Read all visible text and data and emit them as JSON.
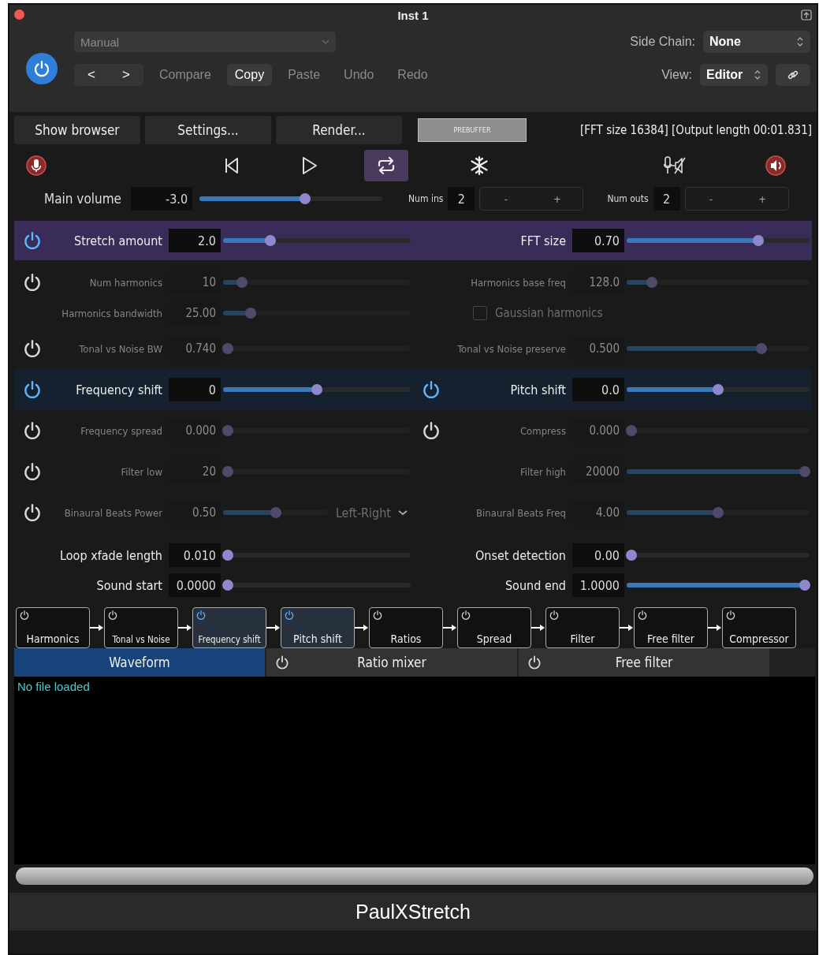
{
  "window": {
    "title": "Inst 1"
  },
  "header": {
    "power": {
      "on": true
    },
    "preset": {
      "value": "Manual",
      "disabled": true
    },
    "nav": [
      {
        "label": "<"
      },
      {
        "label": ">"
      }
    ],
    "buttons": [
      {
        "label": "Compare",
        "disabled": true
      },
      {
        "label": "Copy",
        "disabled": false
      },
      {
        "label": "Paste",
        "disabled": true
      },
      {
        "label": "Undo",
        "disabled": true
      },
      {
        "label": "Redo",
        "disabled": true
      }
    ],
    "side_chain": {
      "label": "Side Chain:",
      "value": "None"
    },
    "view": {
      "label": "View:",
      "value": "Editor"
    }
  },
  "toolbar": {
    "buttons": [
      {
        "label": "Show browser",
        "kind": "button"
      },
      {
        "label": "Settings...",
        "kind": "button"
      },
      {
        "label": "Render...",
        "kind": "button"
      },
      {
        "label": "PREBUFFER",
        "kind": "toggle"
      }
    ],
    "info": "[FFT size 16384] [Output length 00:01.831]"
  },
  "transport": [
    {
      "kind": "record",
      "on": false
    },
    {
      "kind": "rewind",
      "on": false
    },
    {
      "kind": "play",
      "on": false
    },
    {
      "kind": "loop",
      "on": true
    },
    {
      "kind": "freeze",
      "on": false
    },
    {
      "kind": "mute-input",
      "on": false
    },
    {
      "kind": "speaker",
      "on": false
    }
  ],
  "main_volume": {
    "label": "Main volume",
    "value": "-3.0",
    "level": 0.58
  },
  "num_ins": {
    "label": "Num ins",
    "value": "2",
    "buttons": [
      "-",
      "+"
    ]
  },
  "num_outs": {
    "label": "Num outs",
    "value": "2",
    "buttons": [
      "-",
      "+"
    ]
  },
  "rows": [
    {
      "color": "#3a2c58",
      "left": {
        "power": {
          "on": true
        },
        "items": [
          {
            "kind": "slider",
            "label": "Stretch amount",
            "value": "2.0",
            "level": 0.24,
            "disabled": false
          }
        ]
      },
      "right": {
        "items": [
          {
            "kind": "slider",
            "label": "FFT size",
            "value": "0.70",
            "level": 0.73,
            "disabled": false
          }
        ]
      }
    },
    {
      "left": {
        "power": {
          "on": false
        },
        "items": [
          {
            "kind": "slider",
            "label": "Num harmonics",
            "value": "10",
            "level": 0.08,
            "disabled": true
          }
        ]
      },
      "right": {
        "items": [
          {
            "kind": "slider",
            "label": "Harmonics base freq",
            "value": "128.0",
            "level": 0.12,
            "disabled": true
          }
        ]
      }
    },
    {
      "left": {
        "items": [
          {
            "kind": "slider",
            "label": "Harmonics bandwidth",
            "value": "25.00",
            "level": 0.13,
            "disabled": true
          }
        ]
      },
      "right": {
        "items": [
          {
            "kind": "checkbox",
            "label": "Gaussian harmonics",
            "checked": false,
            "disabled": true
          }
        ]
      }
    },
    {
      "left": {
        "power": {
          "on": false
        },
        "items": [
          {
            "kind": "slider",
            "label": "Tonal vs Noise BW",
            "value": "0.740",
            "level": 0,
            "disabled": true
          }
        ]
      },
      "right": {
        "items": [
          {
            "kind": "slider",
            "label": "Tonal vs Noise preserve",
            "value": "0.500",
            "level": 0.75,
            "disabled": true
          }
        ]
      }
    },
    {
      "color": "#15212f",
      "left": {
        "power": {
          "on": true
        },
        "items": [
          {
            "kind": "slider",
            "label": "Frequency shift",
            "value": "0",
            "level": 0.5,
            "disabled": false
          }
        ]
      },
      "right": {
        "power": {
          "on": true
        },
        "items": [
          {
            "kind": "slider",
            "label": "Pitch shift",
            "value": "0.0",
            "level": 0.5,
            "disabled": false
          }
        ]
      }
    },
    {
      "left": {
        "power": {
          "on": false
        },
        "items": [
          {
            "kind": "slider",
            "label": "Frequency spread",
            "value": "0.000",
            "level": 0,
            "disabled": true
          }
        ]
      },
      "right": {
        "power": {
          "on": false
        },
        "items": [
          {
            "kind": "slider",
            "label": "Compress",
            "value": "0.000",
            "level": 0,
            "disabled": true
          }
        ]
      }
    },
    {
      "left": {
        "power": {
          "on": false
        },
        "items": [
          {
            "kind": "slider",
            "label": "Filter low",
            "value": "20",
            "level": 0,
            "disabled": true
          }
        ]
      },
      "right": {
        "items": [
          {
            "kind": "slider",
            "label": "Filter high",
            "value": "20000",
            "level": 1,
            "disabled": true
          }
        ]
      }
    },
    {
      "left": {
        "power": {
          "on": false
        },
        "items": [
          {
            "kind": "slider",
            "label": "Binaural Beats Power",
            "value": "0.50",
            "level": 0.5,
            "disabled": true
          },
          {
            "kind": "dropdown",
            "value": "Left-Right",
            "disabled": true
          }
        ]
      },
      "right": {
        "items": [
          {
            "kind": "slider",
            "label": "Binaural Beats Freq",
            "value": "4.00",
            "level": 0.5,
            "disabled": true
          }
        ]
      }
    },
    {
      "left": {
        "items": [
          {
            "kind": "slider",
            "label": "Loop xfade length",
            "value": "0.010",
            "level": 0,
            "disabled": false
          }
        ]
      },
      "right": {
        "items": [
          {
            "kind": "slider",
            "label": "Onset detection",
            "value": "0.00",
            "level": 0,
            "disabled": false
          }
        ]
      }
    },
    {
      "left": {
        "items": [
          {
            "kind": "slider",
            "label": "Sound start",
            "value": "0.0000",
            "level": 0,
            "disabled": false
          }
        ]
      },
      "right": {
        "items": [
          {
            "kind": "slider",
            "label": "Sound end",
            "value": "1.0000",
            "level": 1,
            "disabled": false
          }
        ]
      }
    }
  ],
  "chain": [
    {
      "label": "Harmonics",
      "on": false
    },
    {
      "label": "Tonal vs Noise",
      "on": false
    },
    {
      "label": "Frequency shift",
      "on": true
    },
    {
      "label": "Pitch shift",
      "on": true
    },
    {
      "label": "Ratios",
      "on": false
    },
    {
      "label": "Spread",
      "on": false
    },
    {
      "label": "Filter",
      "on": false
    },
    {
      "label": "Free filter",
      "on": false
    },
    {
      "label": "Compressor",
      "on": false
    }
  ],
  "tabs": [
    {
      "label": "Waveform",
      "kind": "plain",
      "selected": true
    },
    {
      "label": "Ratio mixer",
      "kind": "toggle",
      "selected": false
    },
    {
      "label": "Free filter",
      "kind": "toggle",
      "selected": false
    }
  ],
  "waveform": {
    "message": "No file loaded"
  },
  "footer": {
    "title": "PaulXStretch"
  }
}
